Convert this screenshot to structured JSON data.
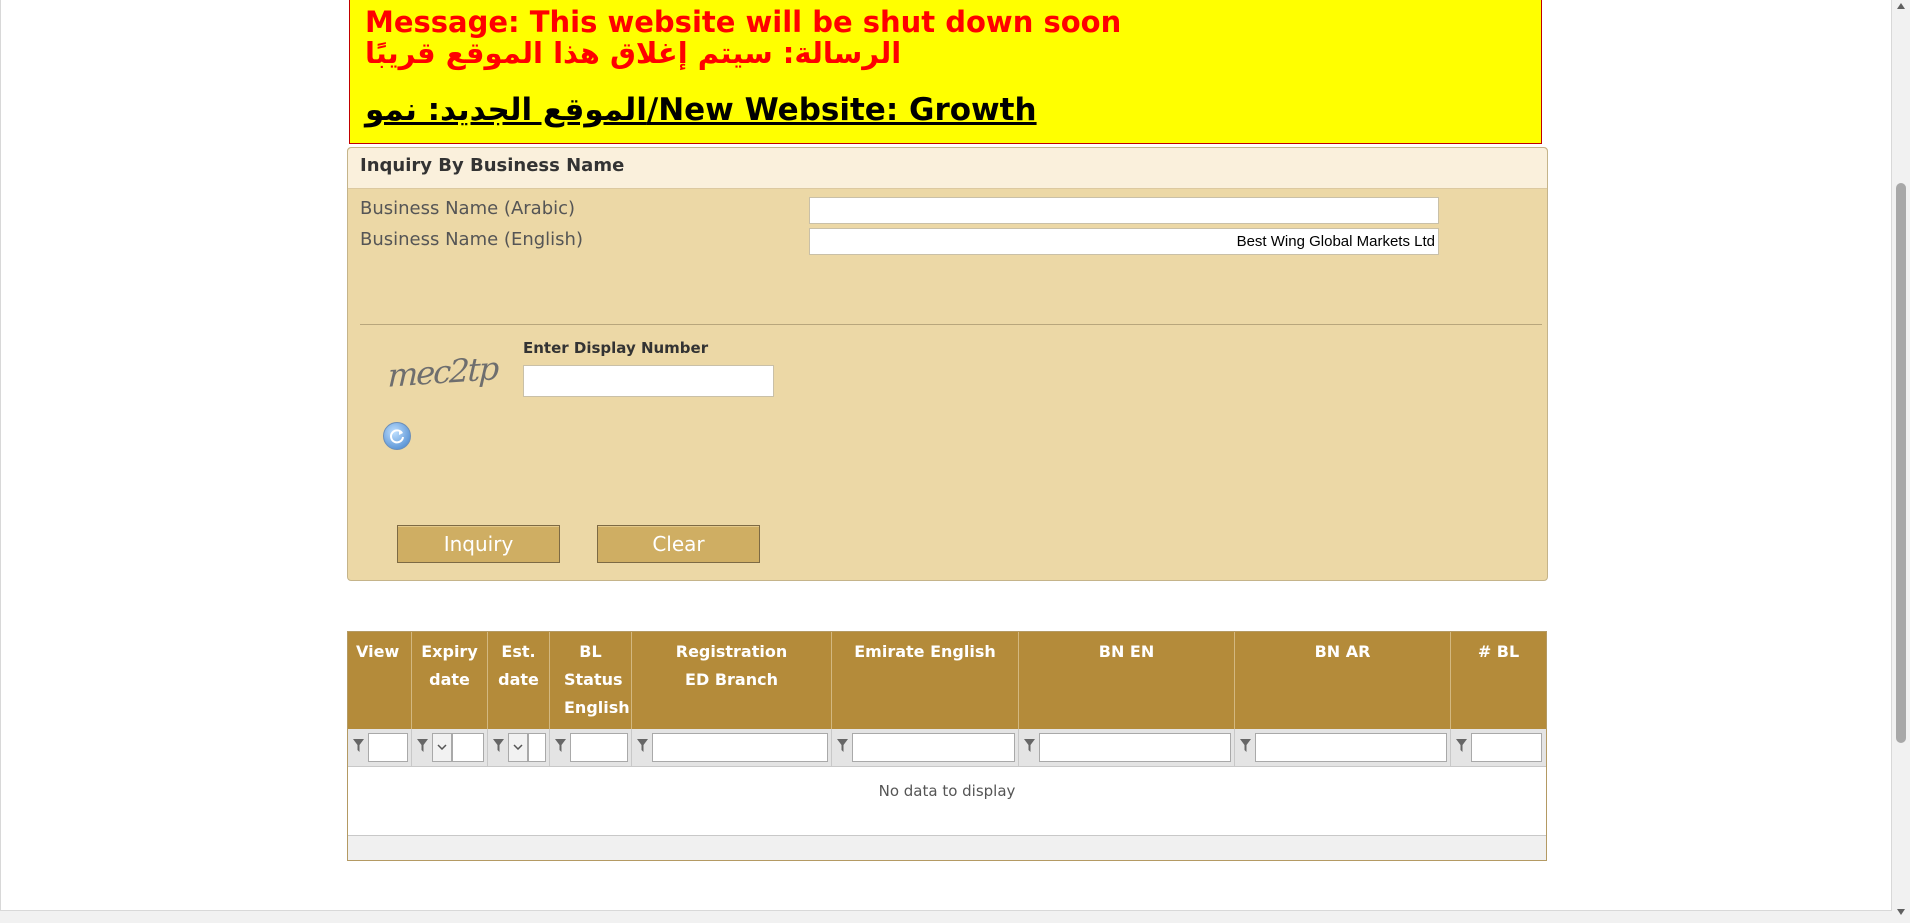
{
  "banner": {
    "message_en": "Message: This website will be shut down soon",
    "message_ar": "الرسالة: سيتم إغلاق هذا الموقع قريبًا",
    "new_website": "الموقع الجديد: نمو/New Website: Growth"
  },
  "inquiry": {
    "title": "Inquiry By Business Name",
    "arabic_label": "Business Name (Arabic)",
    "arabic_value": "",
    "english_label": "Business Name (English)",
    "english_value": "Best Wing Global Markets Ltd",
    "captcha_text": "mec2tp",
    "display_number_label": "Enter Display Number",
    "display_number_value": "",
    "inquiry_button": "Inquiry",
    "clear_button": "Clear"
  },
  "grid": {
    "columns": [
      "View",
      "Expiry date",
      "Est. date",
      "BL Status English",
      "Registration ED Branch",
      "Emirate English",
      "BN EN",
      "BN AR",
      "# BL"
    ],
    "empty_text": "No data to display"
  },
  "icons": {
    "refresh": "refresh-icon",
    "filter": "filter-icon",
    "dropdown": "chevron-down-icon"
  },
  "colors": {
    "banner_bg": "#ffff00",
    "banner_text": "#ff0000",
    "panel_bg": "#ecd8a6",
    "grid_header": "#b48b3a",
    "button": "#cfae63"
  }
}
